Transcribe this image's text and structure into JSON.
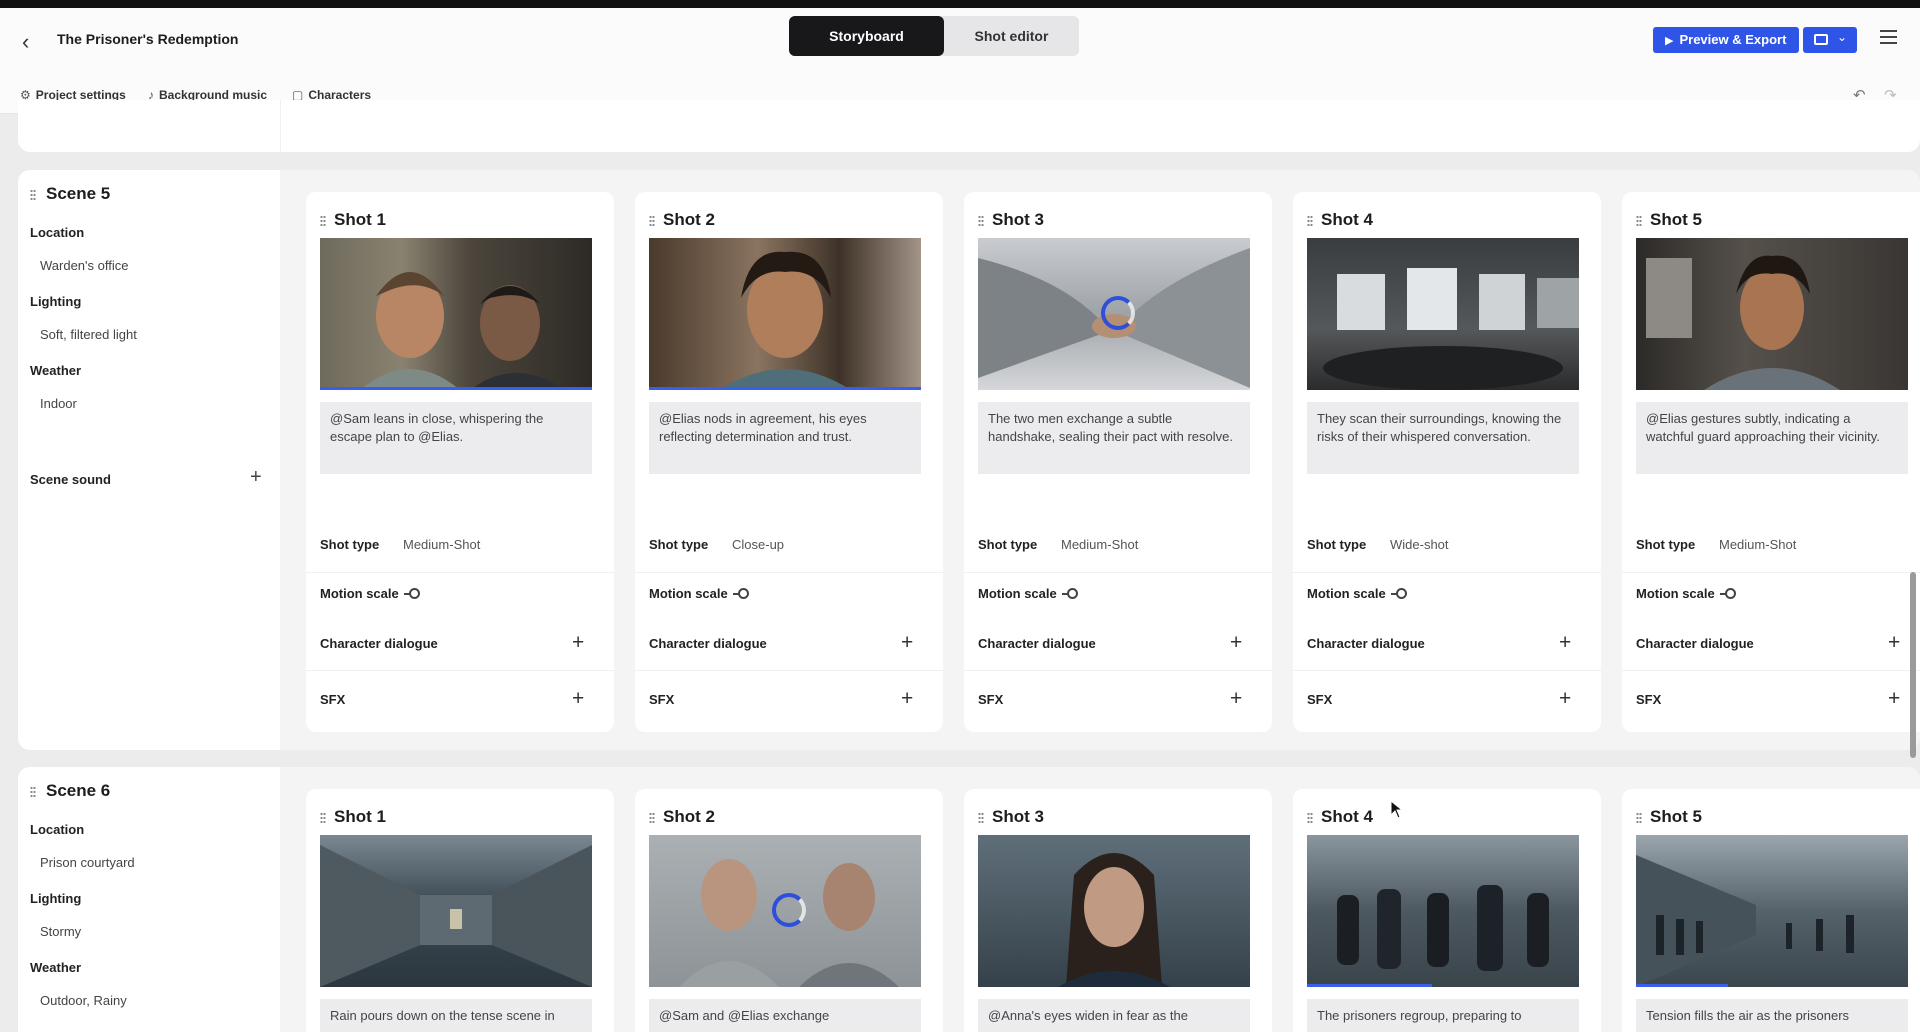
{
  "header": {
    "back_icon": "chevron-left-icon",
    "project_title": "The Prisoner's Redemption",
    "tabs": [
      "Storyboard",
      "Shot editor"
    ],
    "export_label": "Preview & Export",
    "accent_color": "#2f55e8"
  },
  "toolbar": {
    "items": [
      "Project settings",
      "Background music",
      "Characters"
    ]
  },
  "scenes": [
    {
      "title": "Scene 5",
      "location_label": "Location",
      "location": "Warden's office",
      "lighting_label": "Lighting",
      "lighting": "Soft, filtered light",
      "weather_label": "Weather",
      "weather": "Indoor",
      "sound_label": "Scene sound",
      "shots": [
        {
          "title": "Shot 1",
          "desc": "@Sam leans in close, whispering the escape plan to @Elias.",
          "shot_type_label": "Shot type",
          "shot_type": "Medium-Shot",
          "motion_label": "Motion scale",
          "dialogue_label": "Character dialogue",
          "sfx_label": "SFX"
        },
        {
          "title": "Shot 2",
          "desc": "@Elias nods in agreement, his eyes reflecting determination and trust.",
          "shot_type_label": "Shot type",
          "shot_type": "Close-up",
          "motion_label": "Motion scale",
          "dialogue_label": "Character dialogue",
          "sfx_label": "SFX"
        },
        {
          "title": "Shot 3",
          "desc": "The two men exchange a subtle handshake, sealing their pact with resolve.",
          "shot_type_label": "Shot type",
          "shot_type": "Medium-Shot",
          "motion_label": "Motion scale",
          "dialogue_label": "Character dialogue",
          "sfx_label": "SFX"
        },
        {
          "title": "Shot 4",
          "desc": "They scan their surroundings, knowing the risks of their whispered conversation.",
          "shot_type_label": "Shot type",
          "shot_type": "Wide-shot",
          "motion_label": "Motion scale",
          "dialogue_label": "Character dialogue",
          "sfx_label": "SFX"
        },
        {
          "title": "Shot 5",
          "desc": "@Elias gestures subtly, indicating a watchful guard approaching their vicinity.",
          "shot_type_label": "Shot type",
          "shot_type": "Medium-Shot",
          "motion_label": "Motion scale",
          "dialogue_label": "Character dialogue",
          "sfx_label": "SFX"
        }
      ]
    },
    {
      "title": "Scene 6",
      "location_label": "Location",
      "location": "Prison courtyard",
      "lighting_label": "Lighting",
      "lighting": "Stormy",
      "weather_label": "Weather",
      "weather": "Outdoor, Rainy",
      "shots": [
        {
          "title": "Shot 1",
          "desc": "Rain pours down on the tense scene in"
        },
        {
          "title": "Shot 2",
          "desc": "@Sam and @Elias exchange"
        },
        {
          "title": "Shot 3",
          "desc": "@Anna's eyes widen in fear as the"
        },
        {
          "title": "Shot 4",
          "desc": "The prisoners regroup, preparing to"
        },
        {
          "title": "Shot 5",
          "desc": "Tension fills the air as the prisoners"
        }
      ]
    }
  ]
}
